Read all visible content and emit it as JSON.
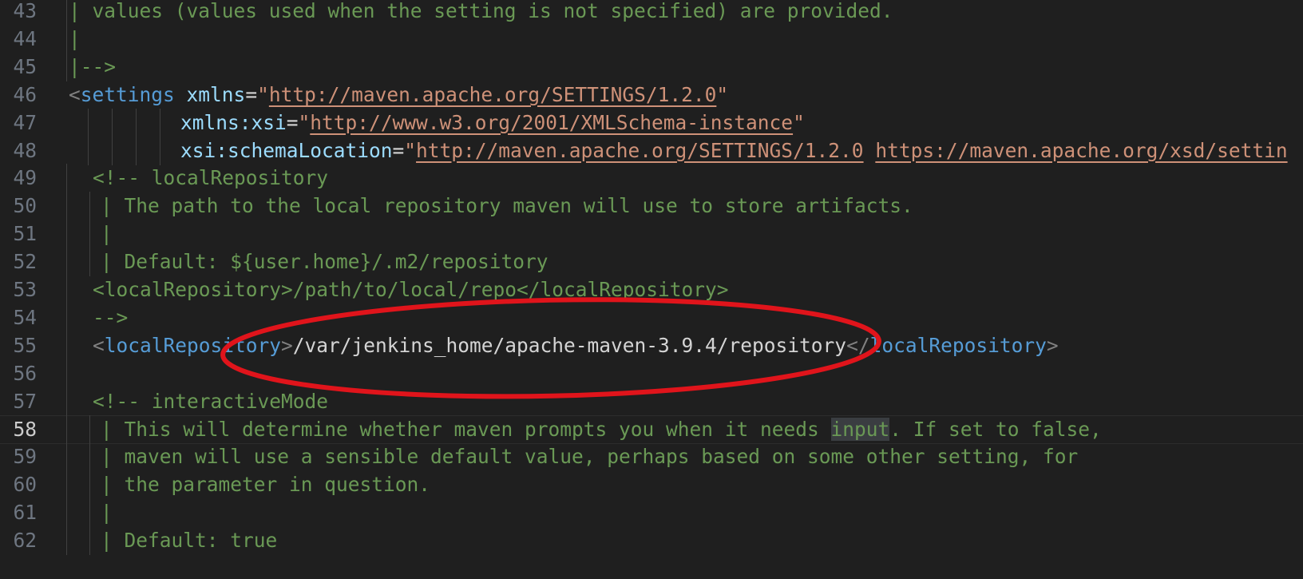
{
  "editor": {
    "active_line": "58",
    "lines": [
      {
        "num": "43",
        "segments": [
          {
            "t": "| values (values used when the setting is not specified) are provided.",
            "c": "cmt"
          }
        ]
      },
      {
        "num": "44",
        "segments": [
          {
            "t": "|",
            "c": "cmt"
          }
        ]
      },
      {
        "num": "45",
        "segments": [
          {
            "t": "|-->",
            "c": "cmt"
          }
        ]
      },
      {
        "num": "46",
        "segments": [
          {
            "t": "<",
            "c": "br"
          },
          {
            "t": "settings",
            "c": "tag"
          },
          {
            "t": " "
          },
          {
            "t": "xmlns",
            "c": "attr"
          },
          {
            "t": "=",
            "c": "text"
          },
          {
            "t": "\"",
            "c": "str"
          },
          {
            "t": "http://maven.apache.org/SETTINGS/1.2.0",
            "c": "url"
          },
          {
            "t": "\"",
            "c": "str"
          }
        ]
      },
      {
        "num": "47",
        "segments": [
          {
            "t": "xmlns:xsi",
            "c": "attr"
          },
          {
            "t": "=",
            "c": "text"
          },
          {
            "t": "\"",
            "c": "str"
          },
          {
            "t": "http://www.w3.org/2001/XMLSchema-instance",
            "c": "url"
          },
          {
            "t": "\"",
            "c": "str"
          }
        ]
      },
      {
        "num": "48",
        "segments": [
          {
            "t": "xsi:schemaLocation",
            "c": "attr"
          },
          {
            "t": "=",
            "c": "text"
          },
          {
            "t": "\"",
            "c": "str"
          },
          {
            "t": "http://maven.apache.org/SETTINGS/1.2.0",
            "c": "url"
          },
          {
            "t": " ",
            "c": "str"
          },
          {
            "t": "https://maven.apache.org/xsd/settin",
            "c": "url"
          }
        ]
      },
      {
        "num": "49",
        "segments": [
          {
            "t": "<!-- localRepository",
            "c": "cmt"
          }
        ]
      },
      {
        "num": "50",
        "segments": [
          {
            "t": "| The path to the local repository maven will use to store artifacts.",
            "c": "cmt"
          }
        ]
      },
      {
        "num": "51",
        "segments": [
          {
            "t": "|",
            "c": "cmt"
          }
        ]
      },
      {
        "num": "52",
        "segments": [
          {
            "t": "| Default: ${user.home}/.m2/repository",
            "c": "cmt"
          }
        ]
      },
      {
        "num": "53",
        "segments": [
          {
            "t": "<localRepository>/path/to/local/repo</localRepository>",
            "c": "cmt"
          }
        ]
      },
      {
        "num": "54",
        "segments": [
          {
            "t": "-->",
            "c": "cmt"
          }
        ]
      },
      {
        "num": "55",
        "segments": [
          {
            "t": "<",
            "c": "br"
          },
          {
            "t": "localRepository",
            "c": "tag"
          },
          {
            "t": ">",
            "c": "br"
          },
          {
            "t": "/var/jenkins_home/apache-maven-3.9.4/repository",
            "c": "text"
          },
          {
            "t": "</",
            "c": "br"
          },
          {
            "t": "localRepository",
            "c": "tag"
          },
          {
            "t": ">",
            "c": "br"
          }
        ]
      },
      {
        "num": "56",
        "segments": []
      },
      {
        "num": "57",
        "segments": [
          {
            "t": "<!-- interactiveMode",
            "c": "cmt"
          }
        ]
      },
      {
        "num": "58",
        "segments": [
          {
            "t": "| This will determine whether maven prompts you when it needs ",
            "c": "cmt"
          },
          {
            "t": "input",
            "c": "cmt hl"
          },
          {
            "t": ". If set to false,",
            "c": "cmt"
          }
        ]
      },
      {
        "num": "59",
        "segments": [
          {
            "t": "| maven will use a sensible default value, perhaps based on some other setting, for",
            "c": "cmt"
          }
        ]
      },
      {
        "num": "60",
        "segments": [
          {
            "t": "| the parameter in question.",
            "c": "cmt"
          }
        ]
      },
      {
        "num": "61",
        "segments": [
          {
            "t": "|",
            "c": "cmt"
          }
        ]
      },
      {
        "num": "62",
        "segments": [
          {
            "t": "| Default: true",
            "c": "cmt"
          }
        ]
      }
    ]
  },
  "annotation": {
    "shape": "ellipse",
    "target_line": "55",
    "color": "#e0141b"
  }
}
